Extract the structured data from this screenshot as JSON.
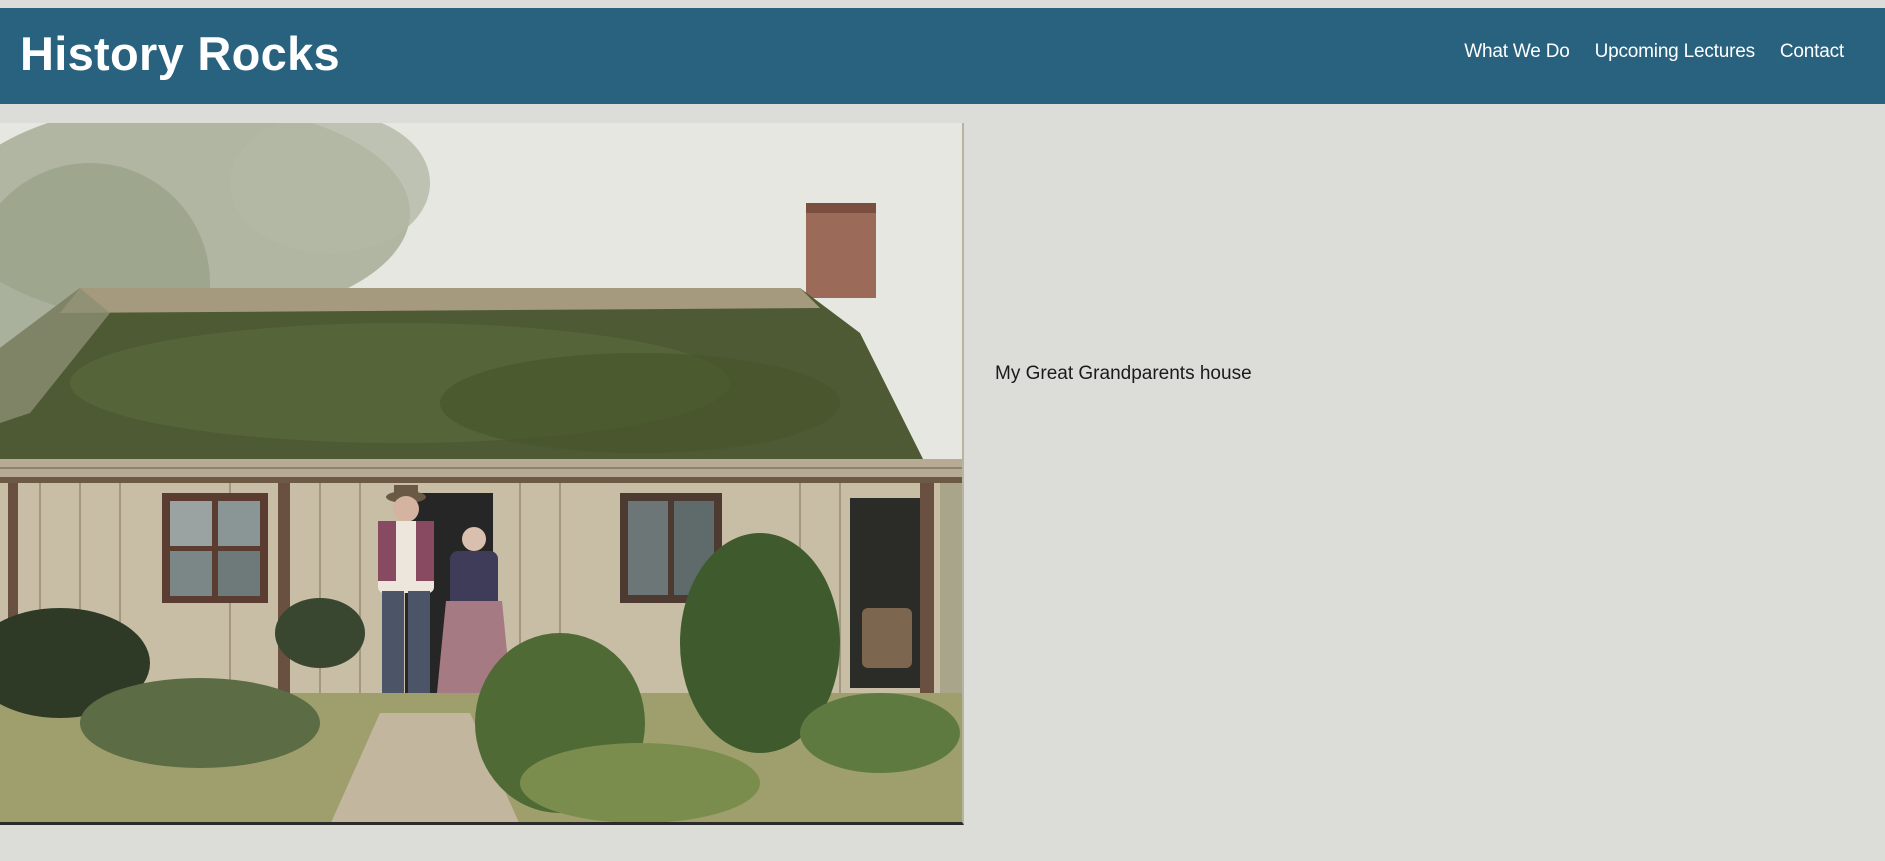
{
  "site": {
    "title": "History Rocks"
  },
  "nav": {
    "items": [
      {
        "label": "What We Do"
      },
      {
        "label": "Upcoming Lectures"
      },
      {
        "label": "Contact"
      }
    ]
  },
  "content": {
    "caption": "My Great Grandparents house"
  },
  "colors": {
    "header": "#29627f",
    "page_background": "#dcddd8",
    "header_text": "#ffffff",
    "caption_text": "#1a1a1a"
  }
}
